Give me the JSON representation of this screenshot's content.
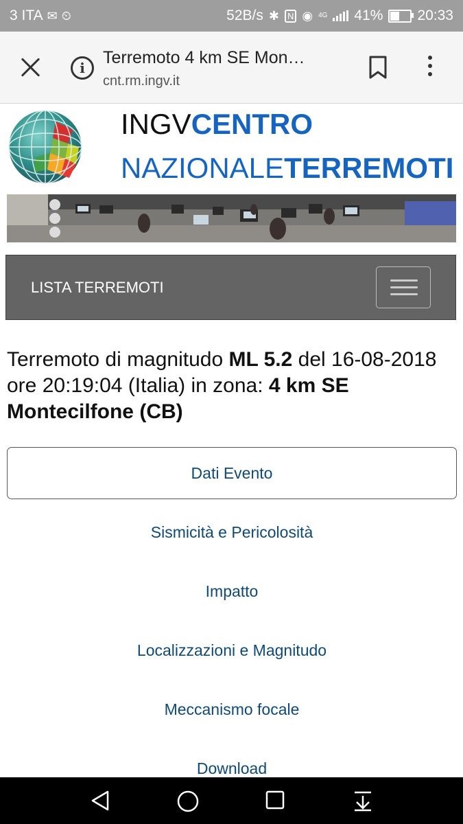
{
  "status_bar": {
    "carrier": "3 ITA",
    "speed": "52B/s",
    "network": "4G",
    "battery": "41%",
    "battery_level": 0.41,
    "time": "20:33"
  },
  "browser": {
    "title": "Terremoto 4 km SE Mon…",
    "url": "cnt.rm.ingv.it"
  },
  "header": {
    "brand_line1_a": "INGV",
    "brand_line1_b": "CENTRO",
    "brand_line2_a": "NAZIONALE",
    "brand_line2_b": "TERREMOTI"
  },
  "nav": {
    "title": "LISTA TERREMOTI"
  },
  "event": {
    "prefix": "Terremoto di magnitudo ",
    "magnitude": "ML 5.2",
    "mid": " del 16-08-2018 ore 20:19:04 (Italia) in zona: ",
    "zone": "4 km SE Montecilfone (CB)"
  },
  "tabs": [
    {
      "label": "Dati Evento",
      "active": true
    },
    {
      "label": "Sismicità e Pericolosità"
    },
    {
      "label": "Impatto"
    },
    {
      "label": "Localizzazioni e Magnitudo"
    },
    {
      "label": "Meccanismo focale"
    },
    {
      "label": "Download"
    }
  ],
  "colors": {
    "brand_blue": "#1565c0",
    "link_blue": "#0d4a7a",
    "navbar_gray": "#646464",
    "status_gray": "#9e9e9e"
  }
}
